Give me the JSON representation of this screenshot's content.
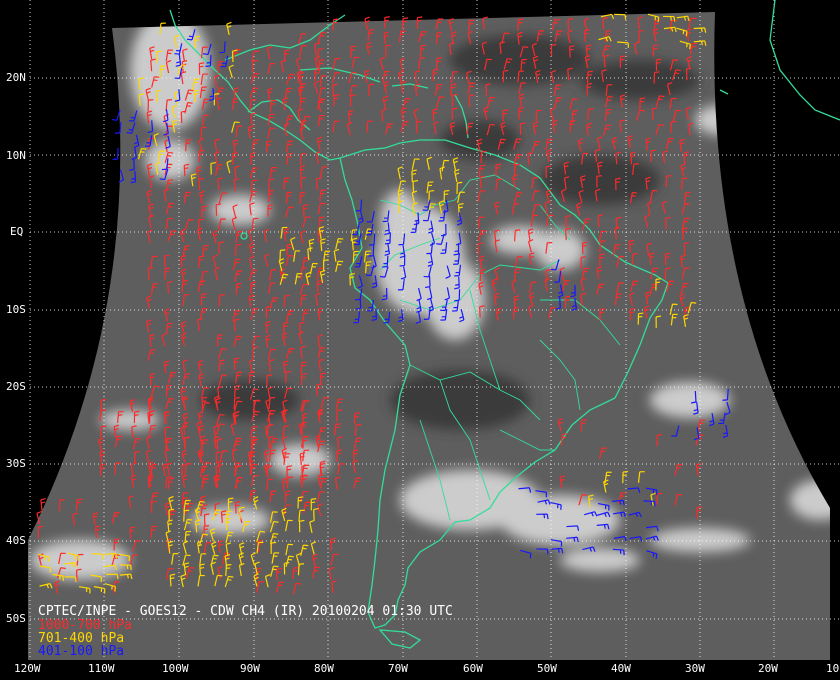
{
  "title": "CPTEC/INPE - GOES12 - CDW CH4 (IR) 20100204 01:30 UTC",
  "legend": [
    {
      "label": "1000-700 hPa",
      "color": "#ff2a2a"
    },
    {
      "label": "701-400 hPa",
      "color": "#ffd800"
    },
    {
      "label": "401-100 hPa",
      "color": "#1818ff"
    }
  ],
  "lat_labels": [
    "20N",
    "10N",
    "EQ",
    "10S",
    "20S",
    "30S",
    "40S",
    "50S"
  ],
  "lon_labels": [
    "120W",
    "110W",
    "100W",
    "90W",
    "80W",
    "70W",
    "60W",
    "50W",
    "40W",
    "30W",
    "20W",
    "10"
  ],
  "colors": {
    "background": "#000000",
    "coastline": "#33dd99",
    "grid": "#ffffff",
    "clouds": "#d8d8d8"
  }
}
